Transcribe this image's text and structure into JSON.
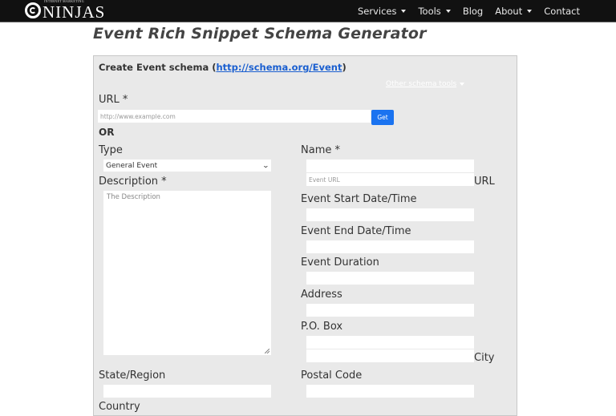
{
  "header": {
    "logo_small": "INTERNET MARKETING",
    "logo_big": "NINJAS",
    "nav": [
      {
        "label": "Services",
        "dropdown": true
      },
      {
        "label": "Tools",
        "dropdown": true
      },
      {
        "label": "Blog",
        "dropdown": false
      },
      {
        "label": "About",
        "dropdown": true
      },
      {
        "label": "Contact",
        "dropdown": false
      }
    ]
  },
  "page": {
    "title": "Event Rich Snippet Schema Generator"
  },
  "form": {
    "heading_prefix": "Create Event schema (",
    "heading_link": "http://schema.org/Event",
    "heading_suffix": ")",
    "other_tools": "Other schema tools",
    "url_label": "URL *",
    "url_placeholder": "http://www.example.com",
    "get_button": "Get",
    "or_label": "OR",
    "type_label": "Type",
    "type_selected": "General Event",
    "description_label": "Description *",
    "description_placeholder": "The Description",
    "name_label": "Name *",
    "name_value": "",
    "event_url_placeholder": "Event URL",
    "url_suffix_label": "URL",
    "start_label": "Event Start Date/Time",
    "end_label": "Event End Date/Time",
    "duration_label": "Event Duration",
    "address_label": "Address",
    "pobox_label": "P.O. Box",
    "city_label": "City",
    "state_label": "State/Region",
    "postal_label": "Postal Code",
    "country_label": "Country"
  }
}
